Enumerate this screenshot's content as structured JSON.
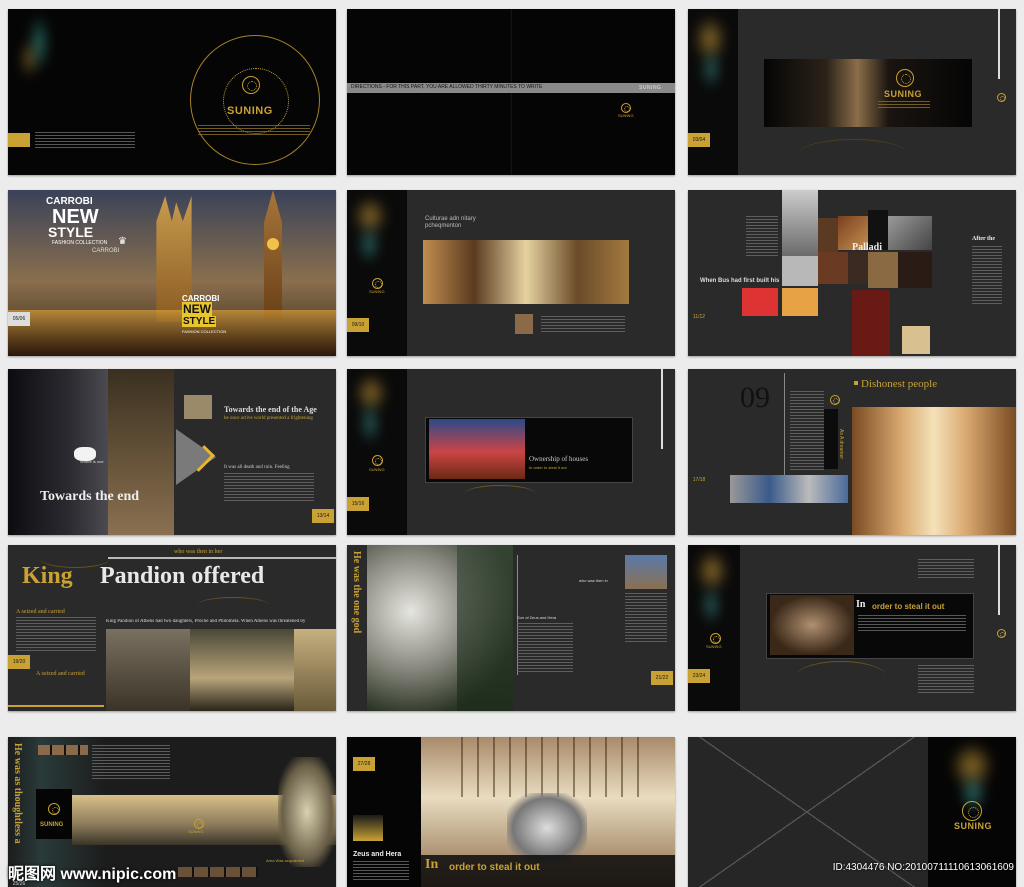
{
  "brand": {
    "name": "SUNING",
    "color": "#c9a233"
  },
  "pages": {
    "p1": {
      "brand": "SUNING",
      "num": ""
    },
    "p2": {
      "banner": "DIRECTIONS - FOR THIS PART, YOU ARE ALLOWED THIRTY MINUTES TO WRITE",
      "brand": "SUNING"
    },
    "p3": {
      "brand": "SUNING",
      "num": "03/04"
    },
    "p4": {
      "carrobi1": "CARROBI",
      "new1": "NEW",
      "style1": "STYLE",
      "fashion1": "FASHION COLLECTION",
      "carrobi2": "CARROBI",
      "carrobi3": "CARROBI",
      "new2": "NEW",
      "style2": "STYLE",
      "fashion2": "FASHION COLLECTION",
      "num": "05/06"
    },
    "p5": {
      "title1": "Culturae adn nitary",
      "title2": "pcheqmenton",
      "brand": "SUNING",
      "num": "09/10"
    },
    "p6": {
      "caption": "When Bus had first built his",
      "palladi": "Palladi",
      "after": "After the",
      "num": "11/12"
    },
    "p7": {
      "heading": "Towards the end of the Age",
      "sub": "be once active world presented a frightening",
      "line3": "It was all death and ruin.   Feeling",
      "big": "Towards the end",
      "small": "Where is one",
      "num": "13/14"
    },
    "p8": {
      "heading": "Ownership of houses",
      "sub": "In order to steal it out",
      "brand": "SUNING",
      "num": "15/16"
    },
    "p9": {
      "big_num": "09",
      "heading": "Dishonest people",
      "vertical": "As A dreamer",
      "num": "17/18"
    },
    "p10": {
      "top": "who was then in her",
      "title_king": "King",
      "title_rest": "Pandion offered",
      "seized1": "A seized and carried",
      "seized2": "A seized and carried",
      "body": "King Pandion of Athens had two daughters,  Procne and Philomela.  When Athens was threatened by",
      "num": "19/20"
    },
    "p11": {
      "vertical": "He was the one god",
      "label1": "who was then in",
      "label2": "Son of Zeus and Hera",
      "num": "21/22"
    },
    "p12": {
      "heading_in": "In",
      "heading_rest": "order to steal it out",
      "brand": "SUNING",
      "num": "23/24"
    },
    "p13": {
      "vertical": "He was as thoughtless a",
      "brand": "SUNING",
      "caption": "Area Was acquainted",
      "num": "25/26"
    },
    "p14": {
      "num": "27/28",
      "title": "Zeus and Hera",
      "heading_in": "In",
      "heading_rest": "order to steal it out"
    },
    "p15": {
      "brand": "SUNING",
      "num": ""
    }
  },
  "watermark": {
    "site": "昵图网 www.nipic.com",
    "id": "ID:4304476 NO:20100711110613061609"
  }
}
